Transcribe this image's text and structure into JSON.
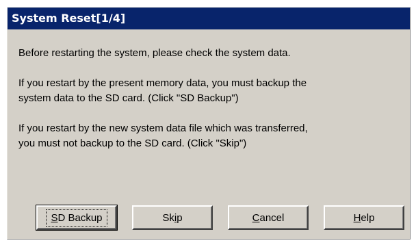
{
  "dialog": {
    "title": "System Reset[1/4]",
    "messages": [
      [
        "Before restarting the system, please check the system data."
      ],
      [
        "If you restart by the present memory data, you must backup the",
        "system data to the SD card. (Click \"SD Backup\")"
      ],
      [
        "If you restart by the new system data file which was transferred,",
        "you must not backup to the SD card. (Click \"Skip\")"
      ]
    ],
    "buttons": {
      "sd_backup": {
        "mnemonic": "S",
        "rest": "D Backup"
      },
      "skip": {
        "pre": "Sk",
        "mnemonic": "i",
        "rest": "p"
      },
      "cancel": {
        "mnemonic": "C",
        "rest": "ancel"
      },
      "help": {
        "mnemonic": "H",
        "rest": "elp"
      }
    }
  }
}
